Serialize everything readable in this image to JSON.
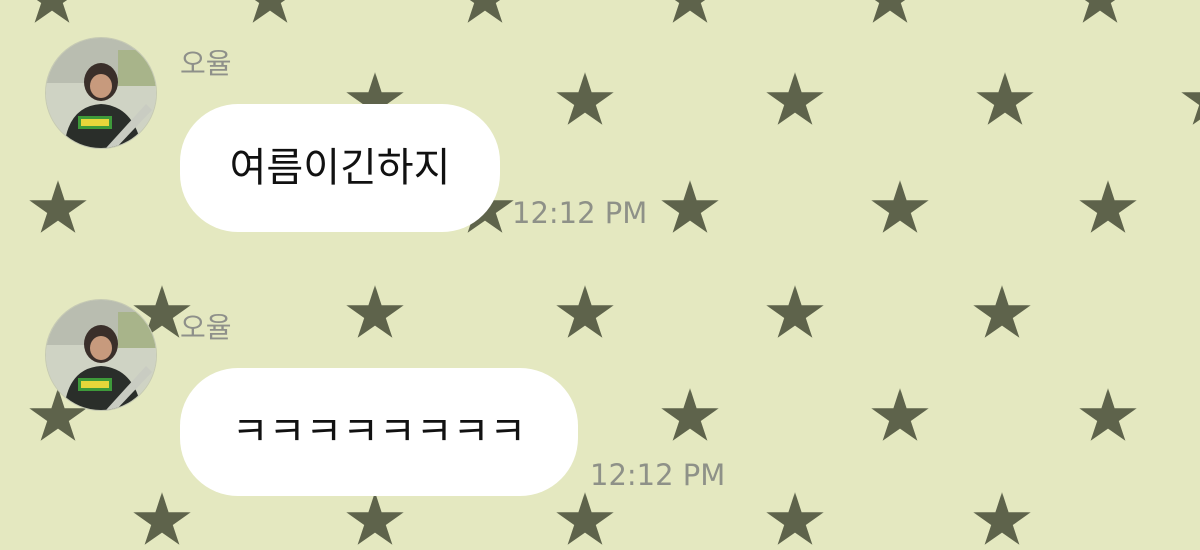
{
  "chat": {
    "messages": [
      {
        "sender": "오율",
        "avatar_icon": "profile-photo-icon",
        "text": "여름이긴하지",
        "time": "12:12 PM"
      },
      {
        "sender": "오율",
        "avatar_icon": "profile-photo-icon",
        "text": "ㅋㅋㅋㅋㅋㅋㅋㅋ",
        "time": "12:12 PM"
      }
    ],
    "background": {
      "pattern": "star",
      "color": "#e4e8c0",
      "star_color": "#4f553f"
    },
    "bubble_color": "#ffffff"
  }
}
